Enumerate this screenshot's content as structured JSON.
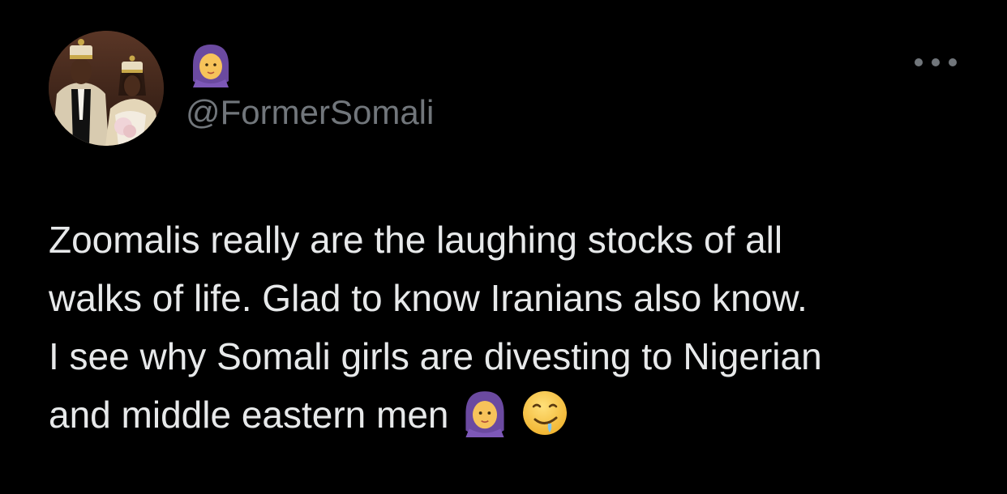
{
  "tweet": {
    "author": {
      "display_name_icon": "woman-with-headscarf-emoji",
      "handle": "@FormerSomali",
      "avatar_icon": "profile-photo"
    },
    "more_icon": "more-options-icon",
    "text_lines": [
      "Zoomalis really are the laughing stocks of all",
      "walks of life. Glad to know Iranians also know.",
      "I see why Somali girls are divesting to Nigerian",
      "and middle eastern men"
    ],
    "trailing_emojis": [
      "woman-with-headscarf-emoji",
      "drooling-face-emoji"
    ]
  },
  "colors": {
    "background": "#000000",
    "primary_text": "#e7e9ea",
    "secondary_text": "#71767b",
    "hijab_purple": "#6b4aa0",
    "emoji_yellow": "#f5c33b"
  }
}
